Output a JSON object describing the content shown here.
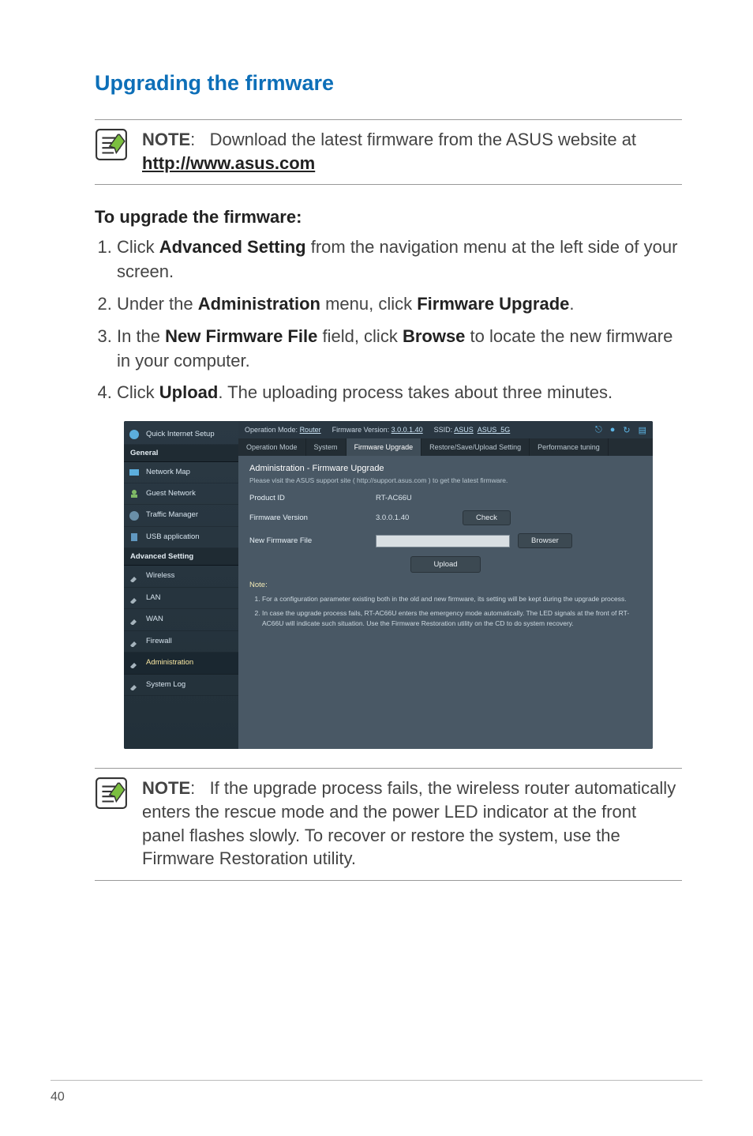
{
  "heading": "Upgrading the firmware",
  "note1": {
    "label": "NOTE",
    "text_before_link": ":   Download the latest firmware from the ASUS website at ",
    "link_text": "http://www.asus.com"
  },
  "subheading": "To upgrade the firmware:",
  "steps": {
    "s1_a": "Click ",
    "s1_b": "Advanced Setting",
    "s1_c": " from the navigation menu at the left side of your screen.",
    "s2_a": "Under the ",
    "s2_b": "Administration",
    "s2_c": " menu, click ",
    "s2_d": "Firmware Upgrade",
    "s2_e": ".",
    "s3_a": "In the ",
    "s3_b": "New Firmware File",
    "s3_c": " field, click ",
    "s3_d": "Browse",
    "s3_e": " to locate the new firmware in your computer.",
    "s4_a": "Click ",
    "s4_b": "Upload",
    "s4_c": ". The uploading process takes about three minutes."
  },
  "screenshot": {
    "topbar": {
      "opmode_label": "Operation Mode:",
      "opmode_value": "Router",
      "fw_label": "Firmware Version:",
      "fw_value": "3.0.0.1.40",
      "ssid_label": "SSID:",
      "ssid_value": "ASUS",
      "ssid_value2": "ASUS_5G"
    },
    "sidebar": {
      "quick": "Quick Internet Setup",
      "group_general": "General",
      "items1": [
        "Network Map",
        "Guest Network",
        "Traffic Manager",
        "USB application"
      ],
      "group_adv": "Advanced Setting",
      "items2": [
        "Wireless",
        "LAN",
        "WAN",
        "Firewall",
        "Administration",
        "System Log"
      ]
    },
    "tabs": [
      "Operation Mode",
      "System",
      "Firmware Upgrade",
      "Restore/Save/Upload Setting",
      "Performance tuning"
    ],
    "panel": {
      "title": "Administration - Firmware Upgrade",
      "sub": "Please visit the ASUS support site ( http://support.asus.com ) to get the latest firmware.",
      "r1_label": "Product ID",
      "r1_value": "RT-AC66U",
      "r2_label": "Firmware Version",
      "r2_value": "3.0.0.1.40",
      "r2_btn": "Check",
      "r3_label": "New Firmware File",
      "r3_btn": "Browser",
      "upload_btn": "Upload",
      "note_head": "Note:",
      "notes": [
        "For a configuration parameter existing both in the old and new firmware, its setting will be kept during the upgrade process.",
        "In case the upgrade process fails, RT-AC66U enters the emergency mode automatically. The LED signals at the front of RT-AC66U will indicate such situation. Use the Firmware Restoration utility on the CD to do system recovery."
      ]
    }
  },
  "note2": {
    "label": "NOTE",
    "text": ":   If the upgrade process fails, the wireless router automatically enters the rescue mode and the power LED indicator at the front panel flashes slowly. To recover or restore the system, use the Firmware Restoration utility."
  },
  "page_number": "40"
}
